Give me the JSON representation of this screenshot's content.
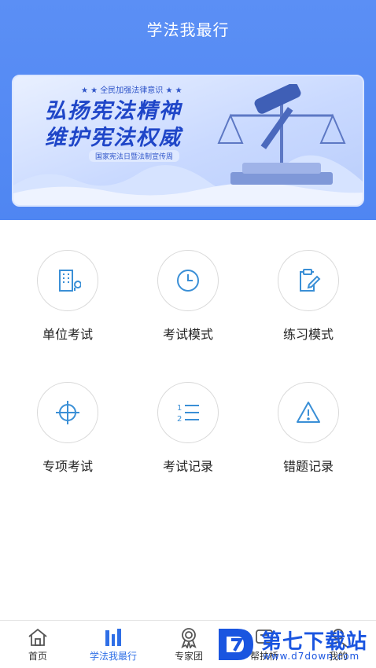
{
  "header": {
    "title": "学法我最行"
  },
  "banner": {
    "tag": "★ ★ 全民加强法律意识 ★ ★",
    "line1": "弘扬宪法精神",
    "line2": "维护宪法权威",
    "sub": "国家宪法日暨法制宣传周"
  },
  "menu": [
    {
      "label": "单位考试",
      "icon": "building-icon"
    },
    {
      "label": "考试模式",
      "icon": "clock-icon"
    },
    {
      "label": "练习模式",
      "icon": "clipboard-edit-icon"
    },
    {
      "label": "专项考试",
      "icon": "crosshair-icon"
    },
    {
      "label": "考试记录",
      "icon": "numbered-list-icon"
    },
    {
      "label": "错题记录",
      "icon": "warning-icon"
    }
  ],
  "tabbar": {
    "items": [
      {
        "label": "首页",
        "icon": "home-icon"
      },
      {
        "label": "学法我最行",
        "icon": "bar-chart-icon"
      },
      {
        "label": "专家团",
        "icon": "medal-icon"
      },
      {
        "label": "帮扶桥",
        "icon": "bridge-icon"
      },
      {
        "label": "我的",
        "icon": "user-icon"
      }
    ],
    "active_color": "#2f6fe6"
  },
  "watermark": {
    "text": "第七下载站",
    "url": "www.d7down.com"
  },
  "colors": {
    "header": "#5b8ff5",
    "icon": "#3a8fd6"
  }
}
